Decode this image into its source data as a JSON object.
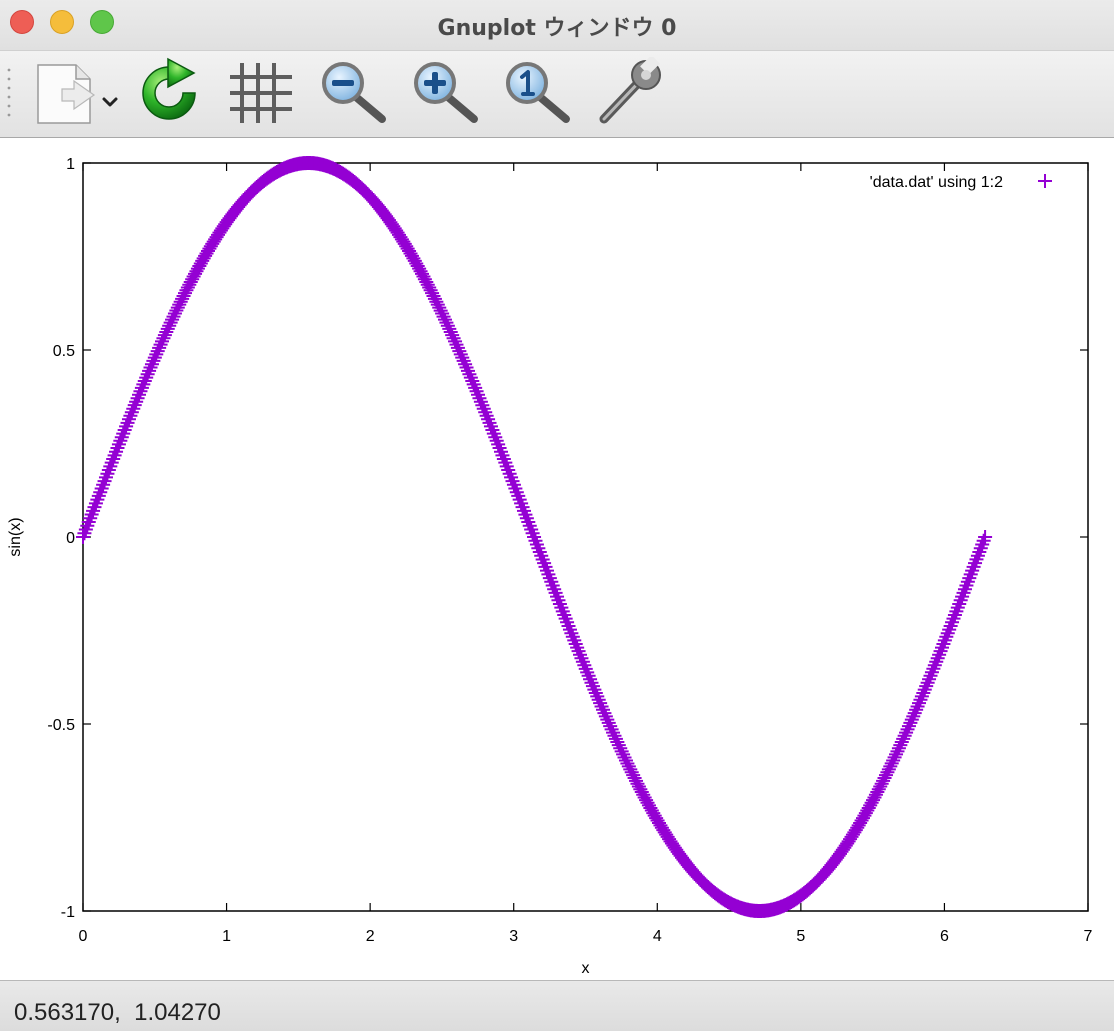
{
  "window": {
    "title": "Gnuplot ウィンドウ 0"
  },
  "toolbar": {
    "buttons": [
      {
        "name": "export-button",
        "icon": "export-document-icon"
      },
      {
        "name": "replot-button",
        "icon": "green-refresh-icon"
      },
      {
        "name": "grid-button",
        "icon": "grid-icon"
      },
      {
        "name": "zoom-out-button",
        "icon": "zoom-out-magnifier-icon"
      },
      {
        "name": "zoom-in-button",
        "icon": "zoom-in-magnifier-icon"
      },
      {
        "name": "zoom-reset-button",
        "icon": "zoom-one-magnifier-icon"
      },
      {
        "name": "settings-button",
        "icon": "wrench-icon"
      }
    ]
  },
  "status": {
    "text": "0.563170,  1.04270"
  },
  "colors": {
    "series": "#9400d3",
    "close": "#ee5e55",
    "minimize": "#f5bd3b",
    "zoom": "#5fc64a",
    "reload": "#1ea61e"
  },
  "chart_data": {
    "type": "scatter",
    "title": "",
    "xlabel": "x",
    "ylabel": "sin(x)",
    "xlim": [
      0,
      7
    ],
    "ylim": [
      -1,
      1
    ],
    "xticks": [
      "0",
      "1",
      "2",
      "3",
      "4",
      "5",
      "6",
      "7"
    ],
    "yticks": [
      "-1",
      "-0.5",
      "0",
      "0.5",
      "1"
    ],
    "grid": false,
    "legend": "top-right",
    "marker": "+",
    "series": [
      {
        "name": "'data.dat' using 1:2",
        "x_range": [
          0,
          6.2832
        ],
        "points": 629,
        "values": [
          [
            0,
            0
          ],
          [
            0.5,
            0.479
          ],
          [
            1,
            0.841
          ],
          [
            1.5708,
            1
          ],
          [
            2,
            0.909
          ],
          [
            2.5,
            0.598
          ],
          [
            3,
            0.141
          ],
          [
            3.5,
            -0.351
          ],
          [
            4,
            -0.757
          ],
          [
            4.7124,
            -1
          ],
          [
            5,
            -0.959
          ],
          [
            5.5,
            -0.706
          ],
          [
            6,
            -0.279
          ],
          [
            6.2832,
            0
          ]
        ]
      }
    ]
  }
}
